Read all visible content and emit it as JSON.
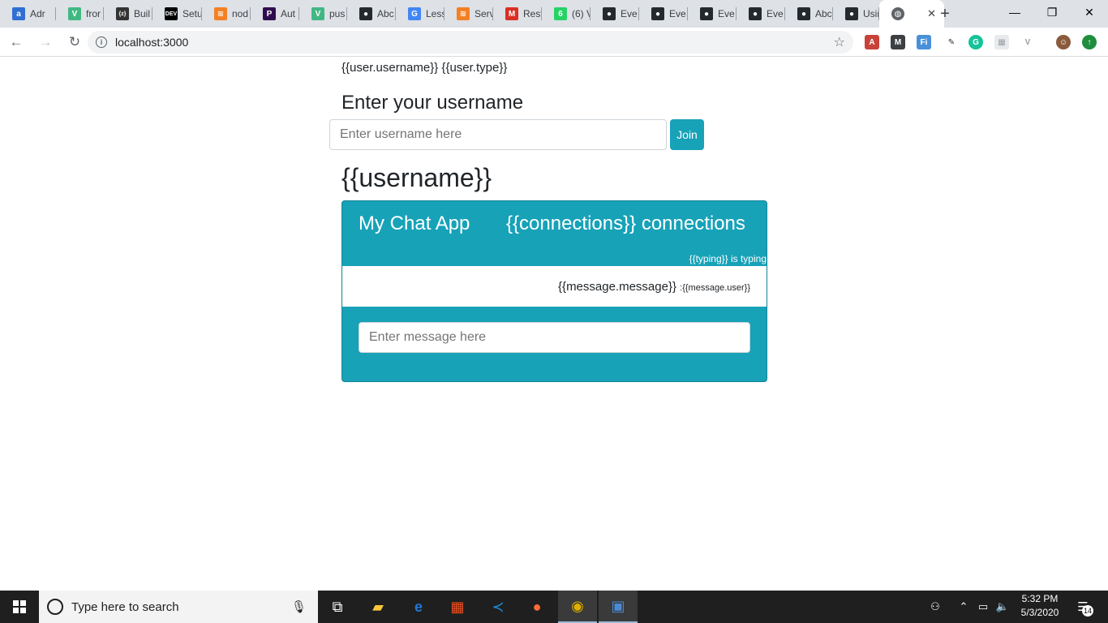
{
  "browser": {
    "tabs": [
      {
        "title": "Adr",
        "icon": "a-icon",
        "color": "#2f6fd2",
        "glyph": "a"
      },
      {
        "title": "fror",
        "icon": "vue-icon",
        "color": "#41b883",
        "glyph": "V"
      },
      {
        "title": "Buil",
        "icon": "z-icon",
        "color": "#333333",
        "glyph": "{z}"
      },
      {
        "title": "Setu",
        "icon": "dev-icon",
        "color": "#000000",
        "glyph": "DEV"
      },
      {
        "title": "nod",
        "icon": "stackoverflow-icon",
        "color": "#f48024",
        "glyph": "≋"
      },
      {
        "title": "Aut",
        "icon": "pusher-icon",
        "color": "#300d4f",
        "glyph": "P"
      },
      {
        "title": "pus",
        "icon": "vue-icon",
        "color": "#41b883",
        "glyph": "V"
      },
      {
        "title": "Abc",
        "icon": "github-icon",
        "color": "#24292e",
        "glyph": "●"
      },
      {
        "title": "Less",
        "icon": "google-icon",
        "color": "#4285f4",
        "glyph": "G"
      },
      {
        "title": "Serv",
        "icon": "stackoverflow-icon",
        "color": "#f48024",
        "glyph": "≋"
      },
      {
        "title": "Rest",
        "icon": "gmail-icon",
        "color": "#d93025",
        "glyph": "M"
      },
      {
        "title": "(6) V",
        "icon": "whatsapp-icon",
        "color": "#25d366",
        "glyph": "6"
      },
      {
        "title": "Eve",
        "icon": "github-icon",
        "color": "#24292e",
        "glyph": "●"
      },
      {
        "title": "Eve",
        "icon": "github-icon",
        "color": "#24292e",
        "glyph": "●"
      },
      {
        "title": "Eve",
        "icon": "github-icon",
        "color": "#24292e",
        "glyph": "●"
      },
      {
        "title": "Eve",
        "icon": "github-icon",
        "color": "#24292e",
        "glyph": "●"
      },
      {
        "title": "Abc",
        "icon": "github-icon",
        "color": "#24292e",
        "glyph": "●"
      },
      {
        "title": "Usin",
        "icon": "github-icon",
        "color": "#24292e",
        "glyph": "●"
      }
    ],
    "active_tab_close": "✕",
    "new_tab": "+",
    "url": "localhost:3000"
  },
  "page": {
    "user_line": "{{user.username}} {{user.type}}",
    "enter_title": "Enter your username",
    "username_placeholder": "Enter username here",
    "join_label": "Join",
    "username_heading": "{{username}}",
    "chat": {
      "title": "My Chat App",
      "connections": "{{connections}} connections",
      "typing": "{{typing}} is typing",
      "message_text": "{{message.message}}",
      "message_user": ":{{message.user}}",
      "message_placeholder": "Enter message here"
    },
    "accent_color": "#17a2b8"
  },
  "taskbar": {
    "search_placeholder": "Type here to search",
    "time": "5:32 PM",
    "date": "5/3/2020",
    "notifications": "14"
  }
}
